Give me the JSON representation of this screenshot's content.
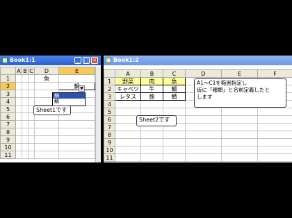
{
  "window1": {
    "title": "Book1:1",
    "columns": [
      "A",
      "B",
      "C",
      "D",
      "E"
    ],
    "rows": [
      "1",
      "2",
      "3",
      "4",
      "5",
      "6",
      "7",
      "8",
      "9",
      "10",
      "11"
    ],
    "d1": "魚",
    "e2": "鯛",
    "dropdown_options": [
      "鯛",
      "鯖"
    ],
    "dropdown_arrow": "▼",
    "callout": "Sheet1です"
  },
  "window2": {
    "title": "Book1:2",
    "columns": [
      "A",
      "B",
      "C",
      "D",
      "E",
      "F"
    ],
    "rows": [
      "1",
      "2",
      "3",
      "4",
      "5",
      "6",
      "7",
      "8",
      "9",
      "10",
      "11"
    ],
    "cells": [
      [
        "野菜",
        "肉",
        "魚"
      ],
      [
        "キャベツ",
        "牛",
        "鯛"
      ],
      [
        "レタス",
        "豚",
        "鯖"
      ]
    ],
    "callout_sheet": "Sheet2です",
    "callout_note_lines": [
      "A1～C1を範囲指定し",
      "仮に「種類」と名前定義したと",
      "します"
    ]
  },
  "colors": {
    "highlight": "#ffff99",
    "active_title": "#2a5fd0",
    "inactive_title": "#7aa0e6"
  }
}
